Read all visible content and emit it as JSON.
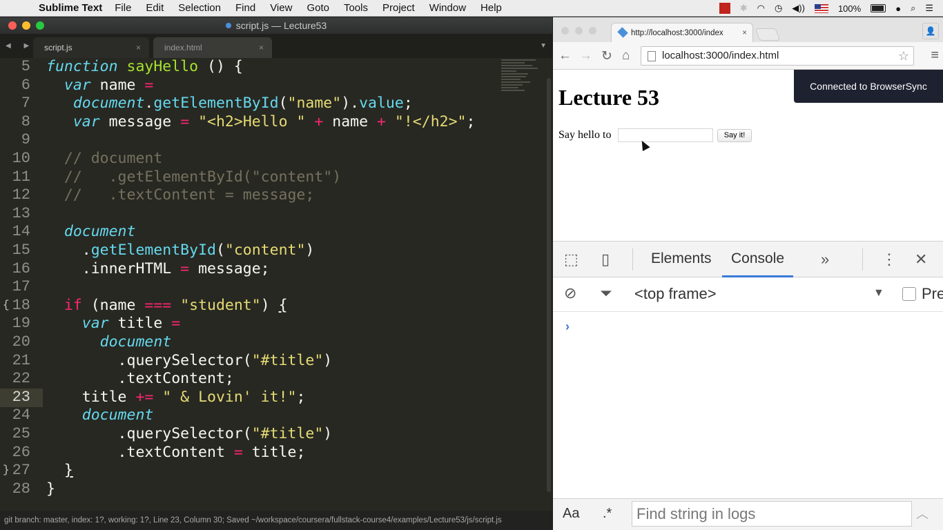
{
  "menubar": {
    "app": "Sublime Text",
    "items": [
      "File",
      "Edit",
      "Selection",
      "Find",
      "View",
      "Goto",
      "Tools",
      "Project",
      "Window",
      "Help"
    ],
    "battery": "100%"
  },
  "sublime": {
    "title": "script.js — Lecture53",
    "tabs": [
      {
        "label": "script.js",
        "active": true
      },
      {
        "label": "index.html",
        "active": false
      }
    ],
    "line_numbers": [
      "5",
      "6",
      "7",
      "8",
      "9",
      "10",
      "11",
      "12",
      "13",
      "14",
      "15",
      "16",
      "17",
      "18",
      "19",
      "20",
      "21",
      "22",
      "23",
      "24",
      "25",
      "26",
      "27",
      "28"
    ],
    "current_line": "23",
    "status": "git branch: master, index: 1?, working: 1?, Line 23, Column 30; Saved ~/workspace/coursera/fullstack-course4/examples/Lecture53/js/script.js"
  },
  "chrome": {
    "tab_title": "http://localhost:3000/index",
    "address": "localhost:3000/index.html",
    "page": {
      "heading": "Lecture 53",
      "label": "Say hello to",
      "button": "Say it!"
    },
    "banner": "Connected to BrowserSync",
    "devtools": {
      "tabs": [
        "Elements",
        "Console"
      ],
      "active_tab": "Console",
      "context": "<top frame>",
      "preserve_label": "Pre",
      "find_placeholder": "Find string in logs",
      "aa": "Aa",
      "regex": ".*"
    }
  }
}
